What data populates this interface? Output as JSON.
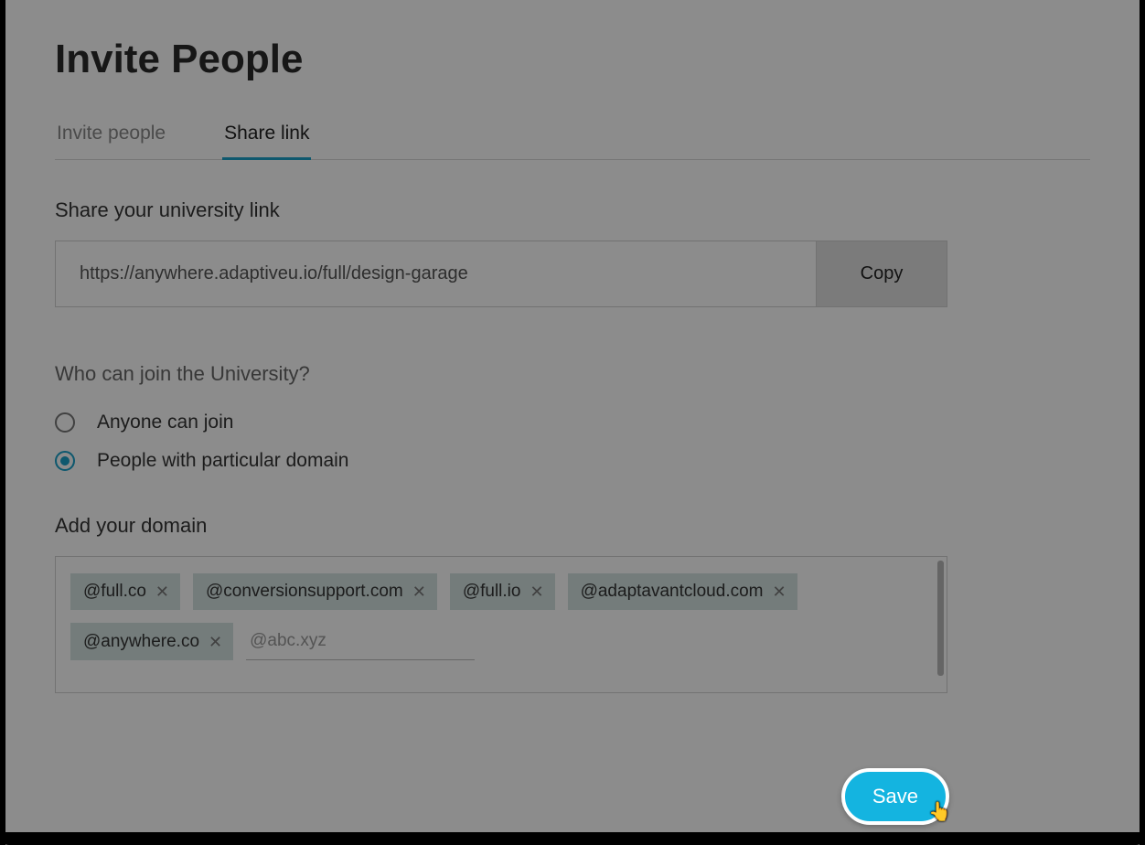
{
  "title": "Invite People",
  "tabs": {
    "invite_people": "Invite people",
    "share_link": "Share link"
  },
  "share_section": {
    "label": "Share your university link",
    "url": "https://anywhere.adaptiveu.io/full/design-garage",
    "copy_label": "Copy"
  },
  "access": {
    "question": "Who can join the University?",
    "option_anyone": "Anyone can join",
    "option_domain": "People with particular domain"
  },
  "domain_section": {
    "label": "Add your domain",
    "chips": [
      "@full.co",
      "@conversionsupport.com",
      "@full.io",
      "@adaptavantcloud.com",
      "@anywhere.co"
    ],
    "placeholder": "@abc.xyz"
  },
  "save_label": "Save"
}
